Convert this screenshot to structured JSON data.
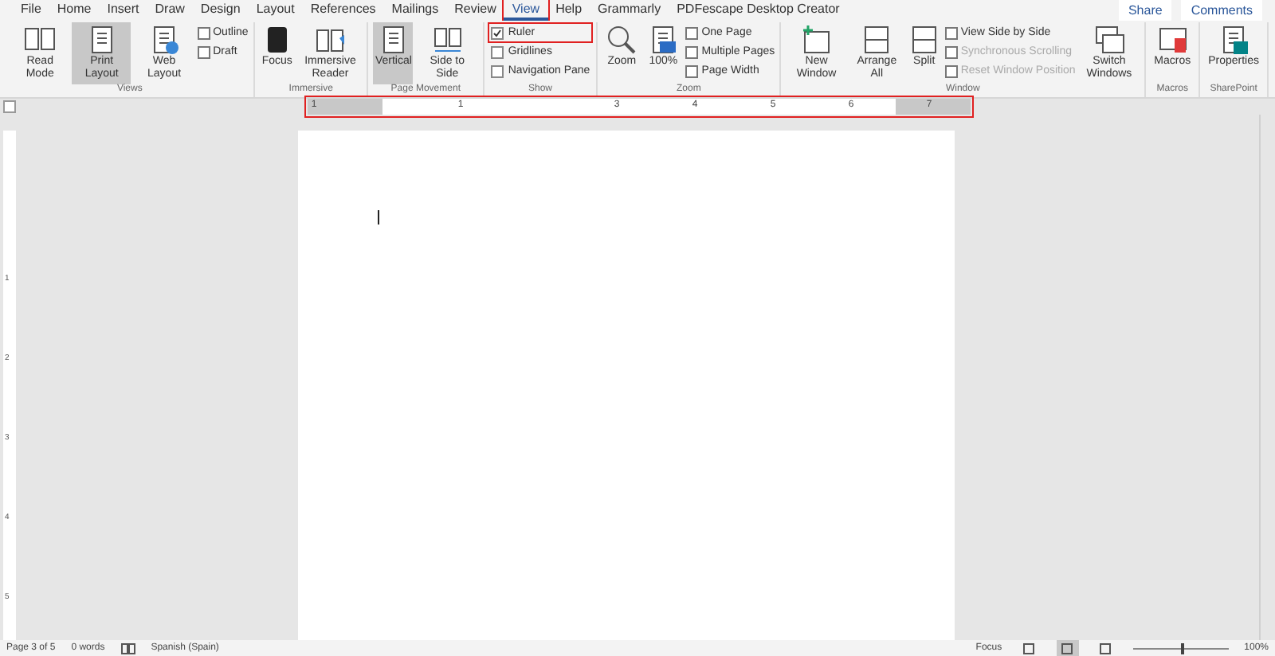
{
  "tabs": [
    {
      "label": "File",
      "selected": false
    },
    {
      "label": "Home",
      "selected": false
    },
    {
      "label": "Insert",
      "selected": false
    },
    {
      "label": "Draw",
      "selected": false
    },
    {
      "label": "Design",
      "selected": false
    },
    {
      "label": "Layout",
      "selected": false
    },
    {
      "label": "References",
      "selected": false
    },
    {
      "label": "Mailings",
      "selected": false
    },
    {
      "label": "Review",
      "selected": false
    },
    {
      "label": "View",
      "selected": true
    },
    {
      "label": "Help",
      "selected": false
    },
    {
      "label": "Grammarly",
      "selected": false
    },
    {
      "label": "PDFescape Desktop Creator",
      "selected": false
    }
  ],
  "share": "Share",
  "comments": "Comments",
  "groups": [
    {
      "name": "Views",
      "items": [
        {
          "kind": "large",
          "label": "Read Mode",
          "selected": false
        },
        {
          "kind": "large",
          "label": "Print Layout",
          "selected": true
        },
        {
          "kind": "large",
          "label": "Web Layout",
          "selected": false
        },
        {
          "kind": "small",
          "label": "Outline",
          "disabled": false
        },
        {
          "kind": "small",
          "label": "Draft",
          "disabled": false
        }
      ]
    },
    {
      "name": "Immersive",
      "items": [
        {
          "kind": "large",
          "label": "Focus",
          "selected": false
        },
        {
          "kind": "large",
          "label": "Immersive Reader",
          "selected": false
        }
      ]
    },
    {
      "name": "Page Movement",
      "items": [
        {
          "kind": "large",
          "label": "Vertical",
          "selected": true
        },
        {
          "kind": "large",
          "label": "Side to Side",
          "selected": false
        }
      ]
    },
    {
      "name": "Show",
      "items": [
        {
          "kind": "checkbox",
          "label": "Ruler",
          "checked": true
        },
        {
          "kind": "checkbox",
          "label": "Gridlines",
          "checked": false
        },
        {
          "kind": "checkbox",
          "label": "Navigation Pane",
          "checked": false
        }
      ]
    },
    {
      "name": "Zoom",
      "items": [
        {
          "kind": "large",
          "label": "Zoom",
          "selected": false
        },
        {
          "kind": "large",
          "label": "100%",
          "selected": false
        },
        {
          "kind": "small",
          "label": "One Page",
          "disabled": false
        },
        {
          "kind": "small",
          "label": "Multiple Pages",
          "disabled": false
        },
        {
          "kind": "small",
          "label": "Page Width",
          "disabled": false
        }
      ]
    },
    {
      "name": "Window",
      "items": [
        {
          "kind": "large",
          "label": "New Window",
          "selected": false
        },
        {
          "kind": "large",
          "label": "Arrange All",
          "selected": false
        },
        {
          "kind": "large",
          "label": "Split",
          "selected": false
        },
        {
          "kind": "small",
          "label": "View Side by Side",
          "disabled": false
        },
        {
          "kind": "small",
          "label": "Synchronous Scrolling",
          "disabled": true
        },
        {
          "kind": "small",
          "label": "Reset Window Position",
          "disabled": true
        },
        {
          "kind": "large",
          "label": "Switch Windows",
          "selected": false
        }
      ]
    },
    {
      "name": "Macros",
      "items": [
        {
          "kind": "large",
          "label": "Macros",
          "selected": false
        }
      ]
    },
    {
      "name": "SharePoint",
      "items": [
        {
          "kind": "large",
          "label": "Properties",
          "selected": false
        }
      ]
    }
  ],
  "ruler": {
    "numbers": [
      "1",
      "1",
      "3",
      "4",
      "5",
      "6",
      "7"
    ]
  },
  "vertical_ruler": {
    "numbers": [
      "1",
      "2",
      "3",
      "4",
      "5"
    ]
  },
  "status_bar": {
    "page": "Page 3 of 5",
    "words": "0 words",
    "language": "Spanish (Spain)",
    "focus": "Focus",
    "views": [
      {
        "selected": false
      },
      {
        "selected": true
      },
      {
        "selected": false
      }
    ],
    "zoom_slider": {
      "level": 0.5
    },
    "zoom": "100%"
  }
}
